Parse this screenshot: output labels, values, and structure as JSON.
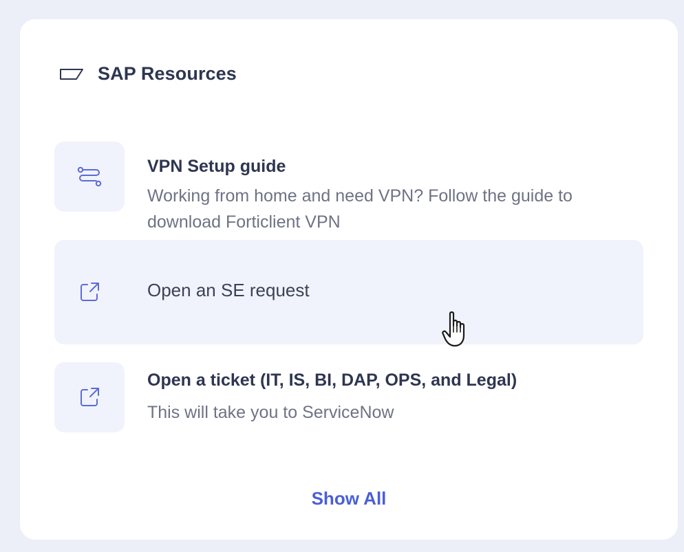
{
  "card": {
    "title": "SAP Resources",
    "header_icon": "tag-icon"
  },
  "resources": [
    {
      "icon": "route-icon",
      "title": "VPN Setup guide",
      "description": "Working from home and need VPN? Follow the guide to download Forticlient VPN"
    },
    {
      "icon": "external-link-icon",
      "title": "Open an SE request",
      "state": "hovered"
    },
    {
      "icon": "external-link-icon",
      "title": "Open a ticket (IT, IS, BI, DAP, OPS, and Legal)",
      "description": "This will take you to ServiceNow"
    }
  ],
  "show_all_label": "Show All",
  "colors": {
    "background": "#eceef8",
    "card": "#ffffff",
    "tile": "#f1f3fc",
    "title_text": "#2e3650",
    "description_text": "#6e7384",
    "link": "#4a5fd6"
  },
  "pointer": "hand-pointer-cursor"
}
